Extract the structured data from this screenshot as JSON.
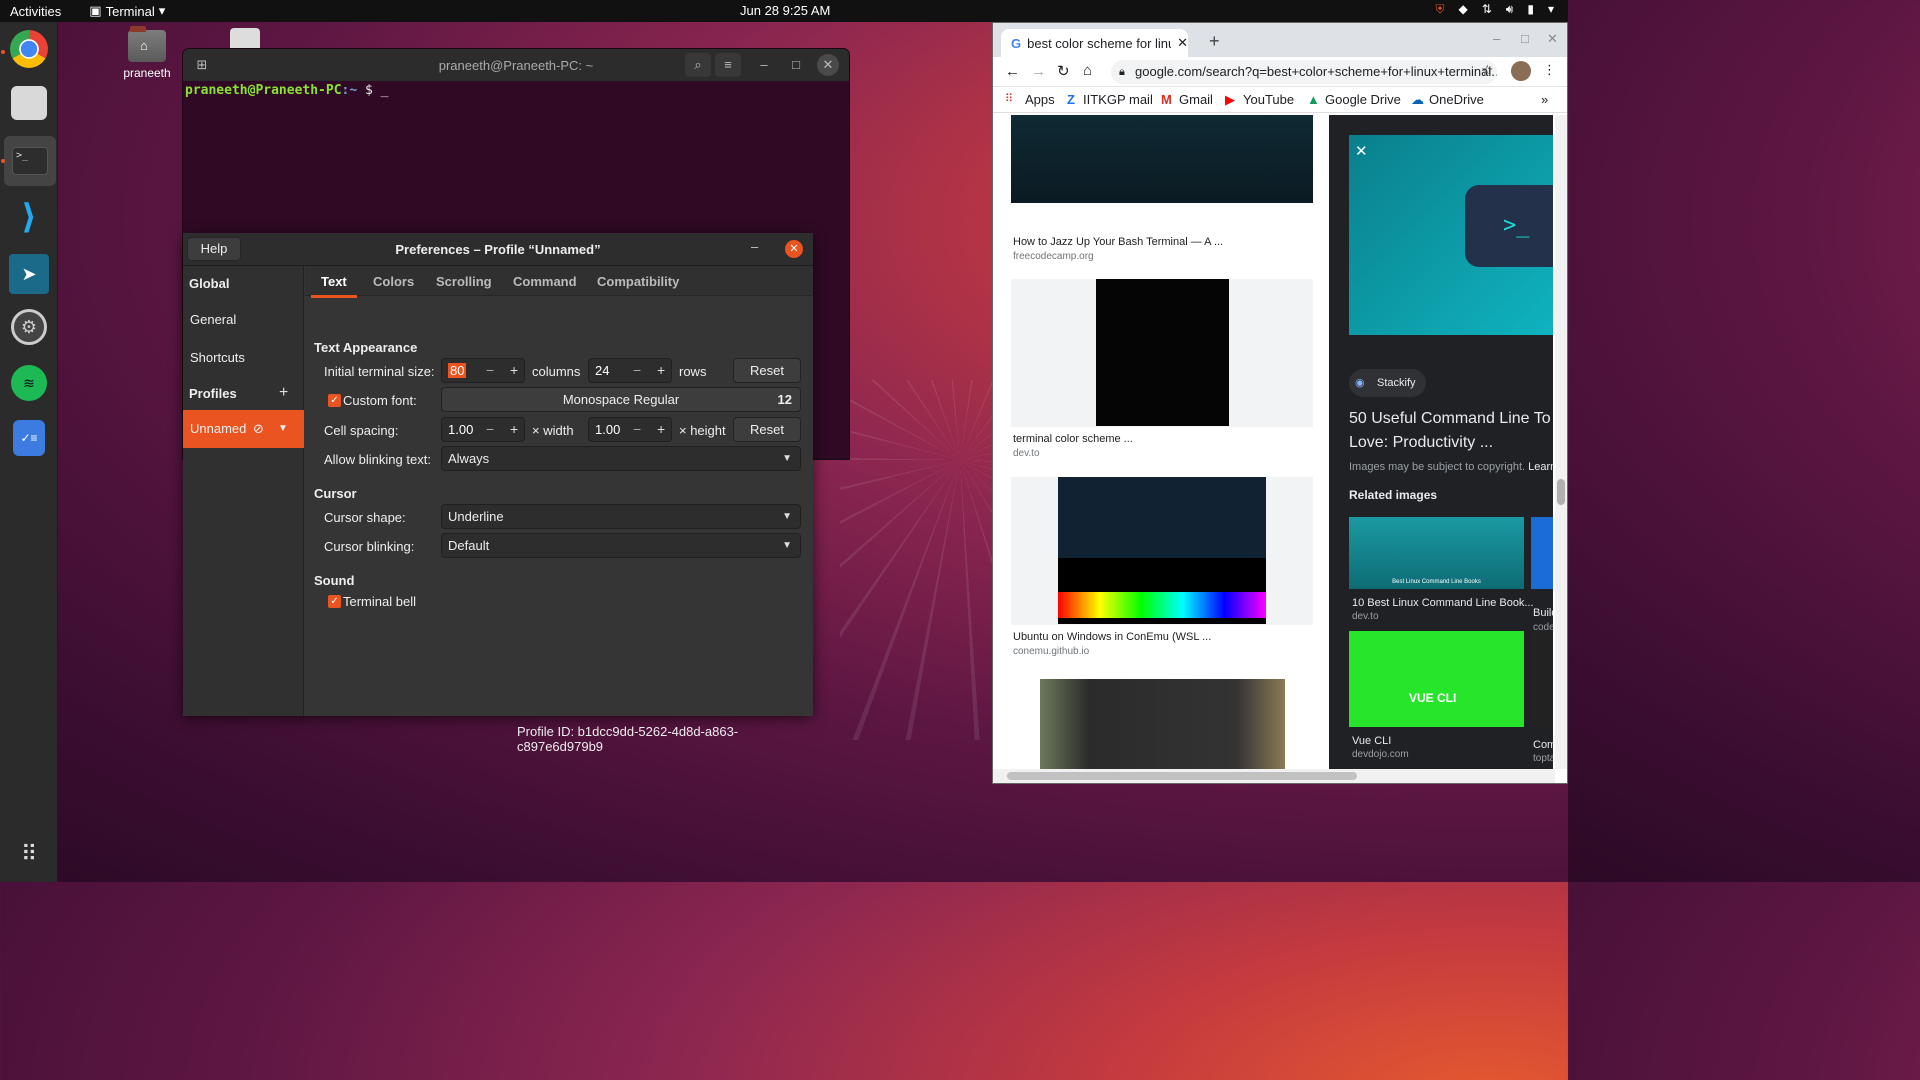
{
  "topbar": {
    "activities": "Activities",
    "app": "Terminal",
    "clock": "Jun 28  9:25 AM"
  },
  "dock": {
    "items": [
      "chrome-icon",
      "files-icon",
      "terminal-icon",
      "vscode-icon",
      "appstore-icon",
      "settings-icon",
      "spotify-icon",
      "todo-icon",
      "show-apps-icon"
    ]
  },
  "desktop": {
    "home_label": "praneeth"
  },
  "terminal": {
    "title": "praneeth@Praneeth-PC: ~",
    "prompt_user": "praneeth@Praneeth-PC",
    "prompt_path": ":~",
    "prompt_sym": "$ _"
  },
  "prefs": {
    "title": "Preferences – Profile “Unnamed”",
    "help": "Help",
    "sidebar": {
      "global": "Global",
      "general": "General",
      "shortcuts": "Shortcuts",
      "profiles": "Profiles",
      "profile_name": "Unnamed"
    },
    "tabs": [
      "Text",
      "Colors",
      "Scrolling",
      "Command",
      "Compatibility"
    ],
    "text_appearance": "Text Appearance",
    "initial_size_label": "Initial terminal size:",
    "columns_value": "80",
    "columns_label": "columns",
    "rows_value": "24",
    "rows_label": "rows",
    "reset": "Reset",
    "custom_font_label": "Custom font:",
    "font_name": "Monospace Regular",
    "font_size": "12",
    "cell_spacing_label": "Cell spacing:",
    "width_value": "1.00",
    "width_label": "× width",
    "height_value": "1.00",
    "height_label": "× height",
    "blink_label": "Allow blinking text:",
    "blink_value": "Always",
    "cursor": "Cursor",
    "cursor_shape_label": "Cursor shape:",
    "cursor_shape_value": "Underline",
    "cursor_blink_label": "Cursor blinking:",
    "cursor_blink_value": "Default",
    "sound": "Sound",
    "bell_label": "Terminal bell",
    "profile_id": "Profile ID:  b1dcc9dd-5262-4d8d-a863-c897e6d979b9"
  },
  "chrome": {
    "tab_title": "best color scheme for linu",
    "url": "google.com/search?q=best+color+scheme+for+linux+terminal...",
    "bookmarks": [
      "Apps",
      "IITKGP mail",
      "Gmail",
      "YouTube",
      "Google Drive",
      "OneDrive"
    ],
    "results": [
      {
        "caption": "How to Jazz Up Your Bash Terminal — A ...",
        "source": "freecodecamp.org"
      },
      {
        "caption": "terminal color scheme ...",
        "source": "dev.to"
      },
      {
        "caption": "Ubuntu on Windows in ConEmu (WSL ...",
        "source": "conemu.github.io"
      }
    ],
    "panel": {
      "site": "Stackify",
      "title": "50 Useful Command Line To Love: Productivity ...",
      "copyright": "Images may be subject to copyright.",
      "learn": "Learn",
      "related": "Related images",
      "rel1": "10 Best Linux Command Line Book...",
      "rel1src": "dev.to",
      "rel2": "Vue CLI",
      "rel2src": "devdojo.com",
      "rel3": "Build",
      "rel3src": "code",
      "rel4": "Com",
      "rel4src": "topta",
      "thumb_text": "Best Linux Command Line Books",
      "vue_text": "VUE CLI"
    }
  },
  "colors": {
    "accent": "#e95420",
    "terminal_bg": "#300a24"
  }
}
